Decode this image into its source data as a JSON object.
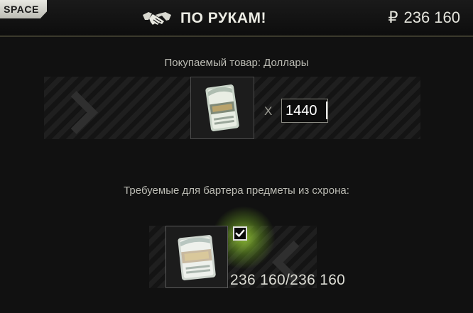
{
  "header": {
    "space_key": "SPACE",
    "deal_label": "ПО РУКАМ!",
    "deal_icon": "handshake-icon",
    "currency_symbol": "₽",
    "balance": "236 160"
  },
  "purchase": {
    "label": "Покупаемый товар: Доллары",
    "item_icon": "dollars-bundle-icon",
    "multiplier": "X",
    "quantity": "1440"
  },
  "barter": {
    "label": "Требуемые для бартера предметы из схрона:",
    "item_icon": "roubles-bundle-icon",
    "checked": true,
    "count": "236 160/236 160"
  },
  "colors": {
    "glow": "#a6e23a",
    "header_border": "#3b3a2c"
  }
}
